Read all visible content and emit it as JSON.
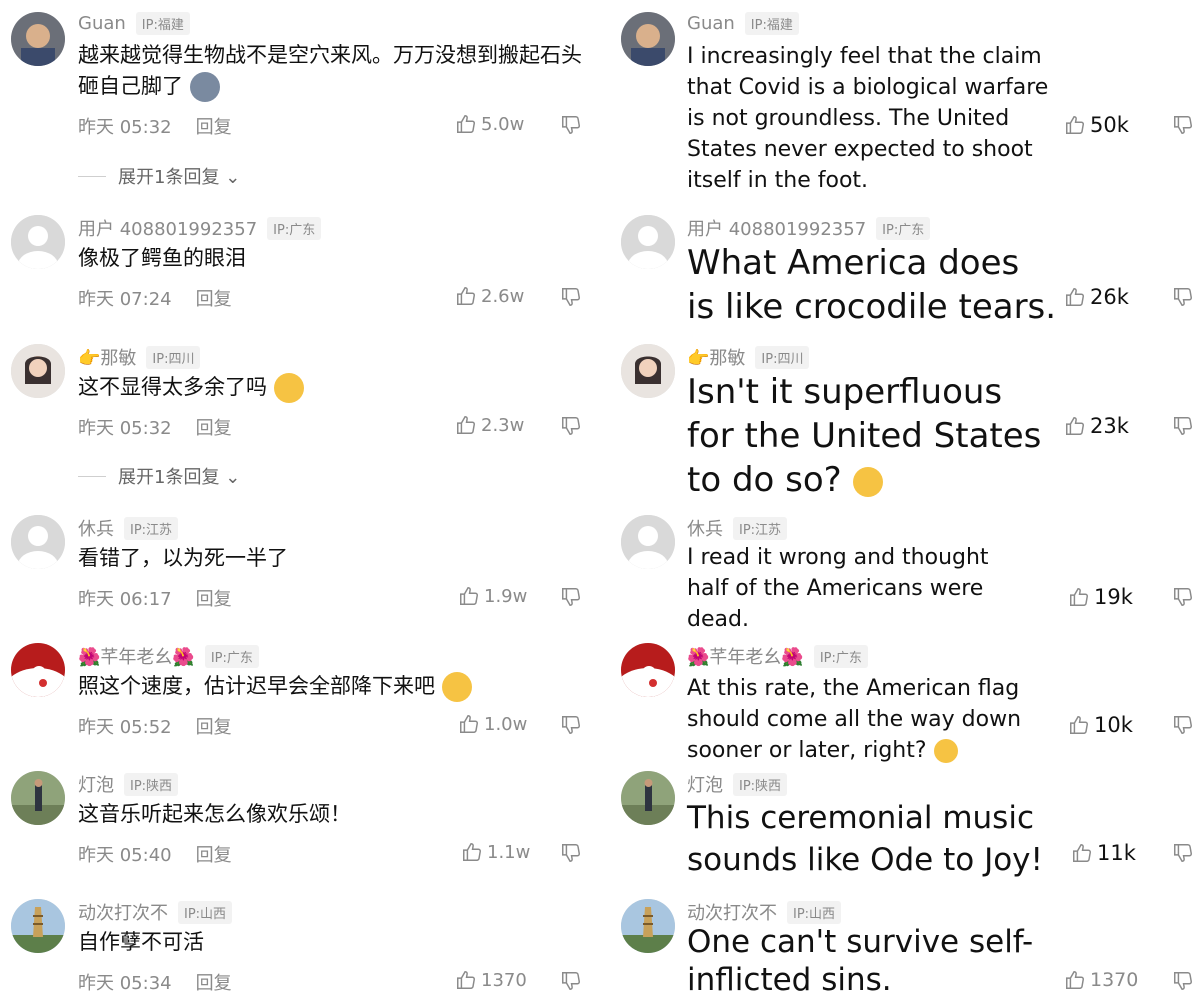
{
  "left": {
    "comments": [
      {
        "user": "Guan",
        "ip": "IP:福建",
        "text": "越来越觉得生物战不是空穴来风。万万没想到搬起石头砸自己脚了",
        "time": "昨天 05:32",
        "reply": "回复",
        "likes": "5.0w"
      },
      {
        "user": "用户 408801992357",
        "ip": "IP:广东",
        "text": "像极了鳄鱼的眼泪",
        "time": "昨天 07:24",
        "reply": "回复",
        "likes": "2.6w"
      },
      {
        "user": "👉那敏",
        "ip": "IP:四川",
        "text": "这不显得太多余了吗",
        "time": "昨天 05:32",
        "reply": "回复",
        "likes": "2.3w"
      },
      {
        "user": "休兵",
        "ip": "IP:江苏",
        "text": "看错了，以为死一半了",
        "time": "昨天 06:17",
        "reply": "回复",
        "likes": "1.9w"
      },
      {
        "user": "🌺芊年老幺🌺",
        "ip": "IP:广东",
        "text": "照这个速度，估计迟早会全部降下来吧",
        "time": "昨天 05:52",
        "reply": "回复",
        "likes": "1.0w"
      },
      {
        "user": "灯泡",
        "ip": "IP:陕西",
        "text": "这音乐听起来怎么像欢乐颂！",
        "time": "昨天 05:40",
        "reply": "回复",
        "likes": "1.1w"
      },
      {
        "user": "动次打次不",
        "ip": "IP:山西",
        "text": "自作孽不可活",
        "time": "昨天 05:34",
        "reply": "回复",
        "likes": "1370"
      }
    ],
    "reply_toggles": [
      "展开1条回复",
      "展开1条回复"
    ]
  },
  "right": {
    "comments": [
      {
        "user": "Guan",
        "ip": "IP:福建",
        "text": "I increasingly feel that the claim that Covid is a biological warfare is not groundless. The United States never expected to shoot itself in the foot.",
        "likes": "50k"
      },
      {
        "user": "用户 408801992357",
        "ip": "IP:广东",
        "text": "What America does is like crocodile tears.",
        "likes": "26k"
      },
      {
        "user": "👉那敏",
        "ip": "IP:四川",
        "text": "Isn't it superfluous for the United States to do so?",
        "likes": "23k"
      },
      {
        "user": "休兵",
        "ip": "IP:江苏",
        "text": "I read it wrong and thought half of the Americans were dead.",
        "likes": "19k"
      },
      {
        "user": "🌺芊年老幺🌺",
        "ip": "IP:广东",
        "text": "At this rate, the American flag should come all the way down sooner or later, right?",
        "likes": "10k"
      },
      {
        "user": "灯泡",
        "ip": "IP:陕西",
        "text": "This ceremonial music sounds like Ode to Joy!",
        "likes": "11k"
      },
      {
        "user": "动次打次不",
        "ip": "IP:山西",
        "text": "One can't survive self-inflicted sins.",
        "likes": "1370"
      }
    ]
  },
  "icons": {
    "like": "thumbs-up-icon",
    "dislike": "thumbs-down-icon",
    "chevron": "chevron-down-icon"
  },
  "colors": {
    "meta_gray": "#8a8a8a",
    "text": "#111111",
    "emoji": "#f6c343"
  }
}
